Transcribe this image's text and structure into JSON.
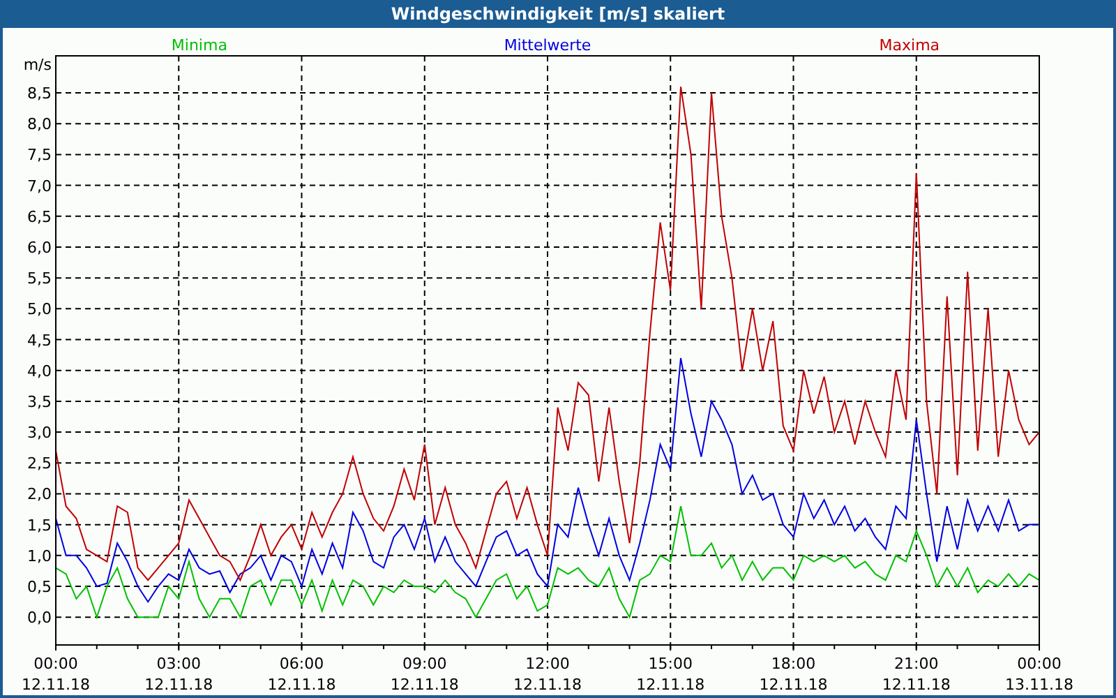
{
  "window": {
    "title": "Windgeschwindigkeit [m/s] skaliert"
  },
  "chart": {
    "chart_data": {
      "type": "line",
      "grid": true,
      "ylabel": "m/s",
      "ylim": [
        -0.45,
        9.1
      ],
      "yticks": [
        {
          "value": 0,
          "label": "0,0"
        },
        {
          "value": 0.5,
          "label": "0,5"
        },
        {
          "value": 1,
          "label": "1,0"
        },
        {
          "value": 1.5,
          "label": "1,5"
        },
        {
          "value": 2,
          "label": "2,0"
        },
        {
          "value": 2.5,
          "label": "2,5"
        },
        {
          "value": 3,
          "label": "3,0"
        },
        {
          "value": 3.5,
          "label": "3,5"
        },
        {
          "value": 4,
          "label": "4,0"
        },
        {
          "value": 4.5,
          "label": "4,5"
        },
        {
          "value": 5,
          "label": "5,0"
        },
        {
          "value": 5.5,
          "label": "5,5"
        },
        {
          "value": 6,
          "label": "6,0"
        },
        {
          "value": 6.5,
          "label": "6,5"
        },
        {
          "value": 7,
          "label": "7,0"
        },
        {
          "value": 7.5,
          "label": "7,5"
        },
        {
          "value": 8,
          "label": "8,0"
        },
        {
          "value": 8.5,
          "label": "8,5"
        }
      ],
      "categories": [
        "00:00\n12.11.18",
        null,
        null,
        null,
        null,
        null,
        null,
        null,
        null,
        null,
        null,
        null,
        "03:00\n12.11.18",
        null,
        null,
        null,
        null,
        null,
        null,
        null,
        null,
        null,
        null,
        null,
        "06:00\n12.11.18",
        null,
        null,
        null,
        null,
        null,
        null,
        null,
        null,
        null,
        null,
        null,
        "09:00\n12.11.18",
        null,
        null,
        null,
        null,
        null,
        null,
        null,
        null,
        null,
        null,
        null,
        "12:00\n12.11.18",
        null,
        null,
        null,
        null,
        null,
        null,
        null,
        null,
        null,
        null,
        null,
        "15:00\n12.11.18",
        null,
        null,
        null,
        null,
        null,
        null,
        null,
        null,
        null,
        null,
        null,
        "18:00\n12.11.18",
        null,
        null,
        null,
        null,
        null,
        null,
        null,
        null,
        null,
        null,
        null,
        "21:00\n12.11.18",
        null,
        null,
        null,
        null,
        null,
        null,
        null,
        null,
        null,
        null,
        null,
        "00:00\n13.11.18"
      ],
      "series": [
        {
          "name": "Minima",
          "color": "#00c000",
          "values": [
            0.8,
            0.7,
            0.3,
            0.5,
            0,
            0.5,
            0.8,
            0.3,
            0,
            0,
            0,
            0.5,
            0.3,
            0.9,
            0.3,
            0,
            0.3,
            0.3,
            0,
            0.5,
            0.6,
            0.2,
            0.6,
            0.6,
            0.2,
            0.6,
            0.1,
            0.6,
            0.2,
            0.6,
            0.5,
            0.2,
            0.5,
            0.4,
            0.6,
            0.5,
            0.5,
            0.4,
            0.6,
            0.4,
            0.3,
            0,
            0.3,
            0.6,
            0.7,
            0.3,
            0.5,
            0.1,
            0.2,
            0.8,
            0.7,
            0.8,
            0.6,
            0.5,
            0.8,
            0.3,
            0,
            0.6,
            0.7,
            1.0,
            0.9,
            1.8,
            1.0,
            1.0,
            1.2,
            0.8,
            1.0,
            0.6,
            0.9,
            0.6,
            0.8,
            0.8,
            0.6,
            1.0,
            0.9,
            1.0,
            0.9,
            1.0,
            0.8,
            0.9,
            0.7,
            0.6,
            1.0,
            0.9,
            1.4,
            1.0,
            0.5,
            0.8,
            0.5,
            0.8,
            0.4,
            0.6,
            0.5,
            0.7,
            0.5,
            0.7,
            0.6
          ]
        },
        {
          "name": "Mittelwerte",
          "color": "#0000e0",
          "values": [
            1.6,
            1.0,
            1.0,
            0.8,
            0.5,
            0.55,
            1.2,
            0.9,
            0.5,
            0.25,
            0.5,
            0.7,
            0.6,
            1.1,
            0.8,
            0.7,
            0.75,
            0.4,
            0.7,
            0.8,
            1.0,
            0.6,
            1.0,
            0.9,
            0.5,
            1.1,
            0.7,
            1.2,
            0.8,
            1.7,
            1.4,
            0.9,
            0.8,
            1.3,
            1.5,
            1.1,
            1.6,
            0.9,
            1.3,
            0.9,
            0.7,
            0.5,
            0.9,
            1.3,
            1.4,
            1.0,
            1.1,
            0.7,
            0.5,
            1.5,
            1.3,
            2.1,
            1.5,
            1.0,
            1.6,
            1.0,
            0.6,
            1.2,
            1.9,
            2.8,
            2.4,
            4.2,
            3.3,
            2.6,
            3.5,
            3.2,
            2.8,
            2.0,
            2.3,
            1.9,
            2.0,
            1.5,
            1.3,
            2.0,
            1.6,
            1.9,
            1.5,
            1.8,
            1.4,
            1.6,
            1.3,
            1.1,
            1.8,
            1.6,
            3.2,
            2.0,
            0.9,
            1.8,
            1.1,
            1.9,
            1.4,
            1.8,
            1.4,
            1.9,
            1.4,
            1.5,
            1.5
          ]
        },
        {
          "name": "Maxima",
          "color": "#c00000",
          "values": [
            2.7,
            1.8,
            1.6,
            1.1,
            1.0,
            0.9,
            1.8,
            1.7,
            0.8,
            0.6,
            0.8,
            1.0,
            1.2,
            1.9,
            1.6,
            1.3,
            1.0,
            0.9,
            0.6,
            1.0,
            1.5,
            1.0,
            1.3,
            1.5,
            1.1,
            1.7,
            1.3,
            1.7,
            2.0,
            2.6,
            2.0,
            1.6,
            1.4,
            1.8,
            2.4,
            1.9,
            2.8,
            1.5,
            2.1,
            1.5,
            1.2,
            0.8,
            1.4,
            2.0,
            2.2,
            1.6,
            2.1,
            1.5,
            1.0,
            3.4,
            2.7,
            3.8,
            3.6,
            2.2,
            3.4,
            2.2,
            1.2,
            2.5,
            4.6,
            6.4,
            5.3,
            8.6,
            7.5,
            5.0,
            8.5,
            6.5,
            5.5,
            4.0,
            5.0,
            4.0,
            4.8,
            3.1,
            2.7,
            4.0,
            3.3,
            3.9,
            3.0,
            3.5,
            2.8,
            3.5,
            3.0,
            2.6,
            4.0,
            3.2,
            7.2,
            3.5,
            2.0,
            5.2,
            2.3,
            5.6,
            2.7,
            5.0,
            2.6,
            4.0,
            3.2,
            2.8,
            3.0
          ]
        }
      ]
    }
  }
}
